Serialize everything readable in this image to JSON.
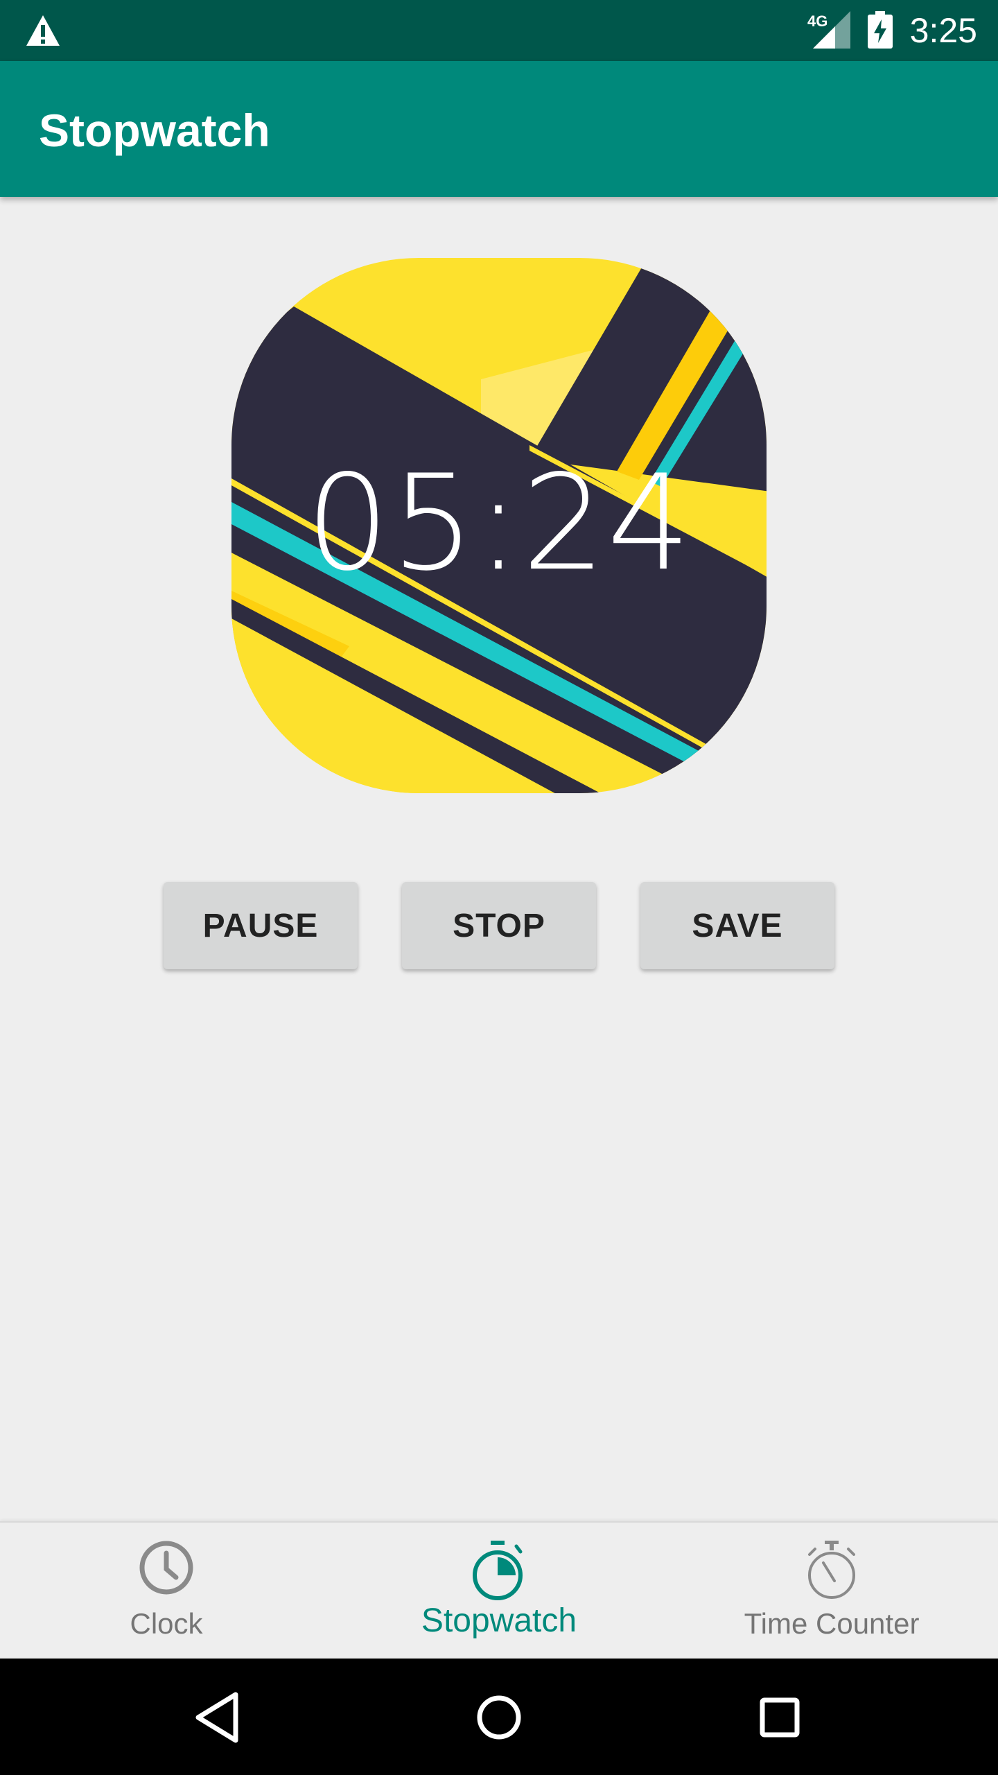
{
  "status_bar": {
    "time": "3:25",
    "network": "4G",
    "icons": [
      "warning-icon",
      "signal-icon",
      "battery-charging-icon"
    ]
  },
  "app_bar": {
    "title": "Stopwatch"
  },
  "timer": {
    "display": "05:24"
  },
  "buttons": {
    "pause": "PAUSE",
    "stop": "STOP",
    "save": "SAVE"
  },
  "bottom_nav": {
    "items": [
      {
        "label": "Clock",
        "icon": "clock-icon",
        "active": false
      },
      {
        "label": "Stopwatch",
        "icon": "stopwatch-icon",
        "active": true
      },
      {
        "label": "Time Counter",
        "icon": "timer-icon",
        "active": false
      }
    ]
  },
  "colors": {
    "status_bar": "#00574b",
    "app_bar": "#00897b",
    "accent": "#00897b",
    "watch_yellow": "#fde12d",
    "watch_navy": "#2e2c40",
    "watch_cyan": "#1dc8c8"
  },
  "system_nav": {
    "icons": [
      "back-icon",
      "home-icon",
      "recents-icon"
    ]
  }
}
